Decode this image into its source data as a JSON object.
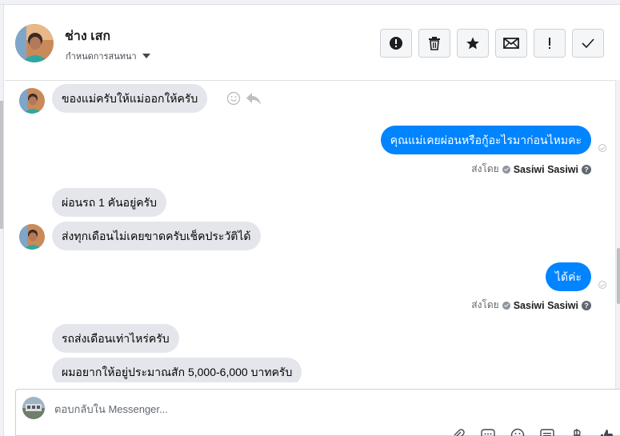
{
  "header": {
    "contact_name": "ช่าง เสก",
    "assign_label": "กำหนดการสนทนา"
  },
  "actions": [
    {
      "icon": "alert-circle-icon"
    },
    {
      "icon": "trash-icon"
    },
    {
      "icon": "star-icon"
    },
    {
      "icon": "envelope-icon"
    },
    {
      "icon": "exclamation-icon"
    },
    {
      "icon": "checkmark-icon"
    }
  ],
  "messages": [
    {
      "direction": "incoming",
      "text": "ของแม่ครับให้แม่ออกให้ครับ"
    },
    {
      "direction": "outgoing",
      "text": "คุณแม่เคยผ่อนหรือกู้อะไรมาก่อนไหมคะ"
    },
    {
      "direction": "incoming",
      "text": "ผ่อนรถ 1 คันอยู่ครับ"
    },
    {
      "direction": "incoming",
      "text": "ส่งทุกเดือนไม่เคยขาดครับเช็คประวัติได้"
    },
    {
      "direction": "outgoing",
      "text": "ได้ค่ะ"
    },
    {
      "direction": "incoming",
      "text": "รถส่งเดือนเท่าไหร่ครับ"
    },
    {
      "direction": "incoming",
      "text": "ผมอยากให้อยู่ประมาณสัก 5,000-6,000 บาทครับ"
    }
  ],
  "sent_by": {
    "prefix": "ส่งโดย",
    "name": "Sasiwi Sasiwi"
  },
  "composer": {
    "placeholder": "ตอบกลับใน Messenger..."
  },
  "colors": {
    "outgoing_bubble": "#0084ff",
    "incoming_bubble": "#e4e6eb"
  }
}
